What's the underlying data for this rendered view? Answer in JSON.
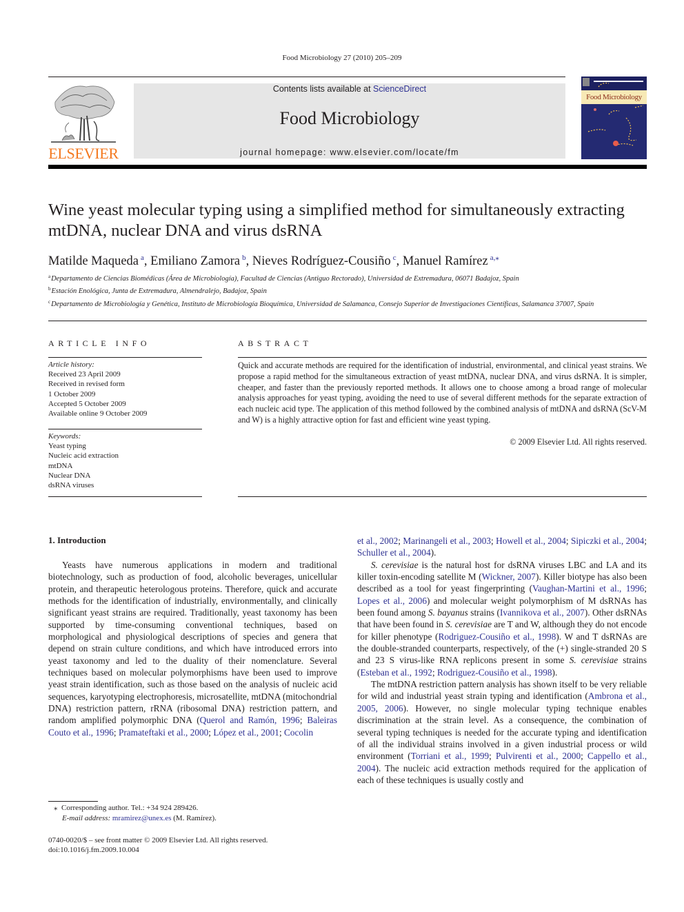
{
  "running_head": "Food Microbiology 27 (2010) 205–209",
  "masthead": {
    "publisher_logo_text": "ELSEVIER",
    "contents_prefix": "Contents lists available at ",
    "contents_link": "ScienceDirect",
    "journal_name": "Food Microbiology",
    "homepage": "journal homepage: www.elsevier.com/locate/fm",
    "cover_title": "Food Microbiology",
    "colors": {
      "elsevier_orange": "#f47920",
      "link_blue": "#2e3192",
      "banner_gray": "#e6e6e6"
    }
  },
  "article": {
    "title": "Wine yeast molecular typing using a simplified method for simultaneously extracting mtDNA, nuclear DNA and virus dsRNA",
    "authors": [
      {
        "name": "Matilde Maqueda",
        "aff": "a"
      },
      {
        "name": "Emiliano Zamora",
        "aff": "b"
      },
      {
        "name": "Nieves Rodríguez-Cousiño",
        "aff": "c"
      },
      {
        "name": "Manuel Ramírez",
        "aff": "a,⁎"
      }
    ],
    "separator": ", ",
    "affiliations": [
      {
        "key": "a",
        "text": "Departamento de Ciencias Biomédicas (Área de Microbiología), Facultad de Ciencias (Antiguo Rectorado), Universidad de Extremadura, 06071 Badajoz, Spain"
      },
      {
        "key": "b",
        "text": "Estación Enológica, Junta de Extremadura, Almendralejo, Badajoz, Spain"
      },
      {
        "key": "c",
        "text": "Departamento de Microbiología y Genética, Instituto de Microbiología Bioquímica, Universidad de Salamanca, Consejo Superior de Investigaciones Científicas, Salamanca 37007, Spain"
      }
    ]
  },
  "article_info": {
    "heading": "ARTICLE INFO",
    "history_label": "Article history:",
    "history": [
      "Received 23 April 2009",
      "Received in revised form",
      "1 October 2009",
      "Accepted 5 October 2009",
      "Available online 9 October 2009"
    ],
    "keywords_label": "Keywords:",
    "keywords": [
      "Yeast typing",
      "Nucleic acid extraction",
      "mtDNA",
      "Nuclear DNA",
      "dsRNA viruses"
    ]
  },
  "abstract": {
    "heading": "ABSTRACT",
    "text": "Quick and accurate methods are required for the identification of industrial, environmental, and clinical yeast strains. We propose a rapid method for the simultaneous extraction of yeast mtDNA, nuclear DNA, and virus dsRNA. It is simpler, cheaper, and faster than the previously reported methods. It allows one to choose among a broad range of molecular analysis approaches for yeast typing, avoiding the need to use of several different methods for the separate extraction of each nucleic acid type. The application of this method followed by the combined analysis of mtDNA and dsRNA (ScV-M and W) is a highly attractive option for fast and efficient wine yeast typing.",
    "copyright": "© 2009 Elsevier Ltd. All rights reserved."
  },
  "body": {
    "section_heading": "1.  Introduction",
    "left": {
      "p1_text": "Yeasts have numerous applications in modern and traditional biotechnology, such as production of food, alcoholic beverages, unicellular protein, and therapeutic heterologous proteins. Therefore, quick and accurate methods for the identification of industrially, environmentally, and clinically significant yeast strains are required. Traditionally, yeast taxonomy has been supported by time-consuming conventional techniques, based on morphological and physiological descriptions of species and genera that depend on strain culture conditions, and which have introduced errors into yeast taxonomy and led to the duality of their nomenclature. Several techniques based on molecular polymorphisms have been used to improve yeast strain identification, such as those based on the analysis of nucleic acid sequences, karyotyping electrophoresis, microsatellite, mtDNA (mitochondrial DNA) restriction pattern, rRNA (ribosomal DNA) restriction pattern, and random amplified polymorphic DNA (",
      "p1_refs": [
        "Querol and Ramón, 1996",
        "Baleiras Couto et al., 1996",
        "Pramateftaki et al., 2000",
        "López et al., 2001",
        "Cocolin"
      ]
    },
    "right": {
      "cont_refs": [
        "et al., 2002",
        "Marinangeli et al., 2003",
        "Howell et al., 2004",
        "Sipiczki et al., 2004",
        "Schuller et al., 2004"
      ],
      "cont_end": ").",
      "p2": [
        {
          "t": "S. cerevisiae",
          "style": "italic"
        },
        {
          "t": " is the natural host for dsRNA viruses LBC and LA and its killer toxin-encoding satellite M ("
        },
        {
          "t": "Wickner, 2007",
          "style": "link"
        },
        {
          "t": "). Killer biotype has also been described as a tool for yeast fingerprinting ("
        },
        {
          "t": "Vaughan-Martini et al., 1996",
          "style": "link"
        },
        {
          "t": "; "
        },
        {
          "t": "Lopes et al., 2006",
          "style": "link"
        },
        {
          "t": ") and molecular weight polymorphism of M dsRNAs has been found among "
        },
        {
          "t": "S. bayanus",
          "style": "italic"
        },
        {
          "t": " strains ("
        },
        {
          "t": "Ivannikova et al., 2007",
          "style": "link"
        },
        {
          "t": "). Other dsRNAs that have been found in "
        },
        {
          "t": "S. cerevisiae",
          "style": "italic"
        },
        {
          "t": " are T and W, although they do not encode for killer phenotype ("
        },
        {
          "t": "Rodriguez-Cousiño et al., 1998",
          "style": "link"
        },
        {
          "t": "). W and T dsRNAs are the double-stranded counterparts, respectively, of the (+) single-stranded 20 S and 23 S virus-like RNA replicons present in some "
        },
        {
          "t": "S. cerevisiae",
          "style": "italic"
        },
        {
          "t": " strains ("
        },
        {
          "t": "Esteban et al., 1992",
          "style": "link"
        },
        {
          "t": "; "
        },
        {
          "t": "Rodriguez-Cousiño et al., 1998",
          "style": "link"
        },
        {
          "t": ")."
        }
      ],
      "p3": [
        {
          "t": "The mtDNA restriction pattern analysis has shown itself to be very reliable for wild and industrial yeast strain typing and identification ("
        },
        {
          "t": "Ambrona et al., 2005, 2006",
          "style": "link"
        },
        {
          "t": "). However, no single molecular typing technique enables discrimination at the strain level. As a consequence, the combination of several typing techniques is needed for the accurate typing and identification of all the individual strains involved in a given industrial process or wild environment ("
        },
        {
          "t": "Torriani et al., 1999",
          "style": "link"
        },
        {
          "t": "; "
        },
        {
          "t": "Pulvirenti et al., 2000",
          "style": "link"
        },
        {
          "t": "; "
        },
        {
          "t": "Cappello et al., 2004",
          "style": "link"
        },
        {
          "t": "). The nucleic acid extraction methods required for the application of each of these techniques is usually costly and"
        }
      ]
    }
  },
  "footnote": {
    "marker": "⁎",
    "corresponding": "Corresponding author. Tel.: +34 924 289426.",
    "email_label": "E-mail address:",
    "email": "mramirez@unex.es",
    "email_suffix": " (M. Ramírez)."
  },
  "front_matter": {
    "issn_line": "0740-0020/$ – see front matter © 2009 Elsevier Ltd. All rights reserved.",
    "doi": "doi:10.1016/j.fm.2009.10.004"
  }
}
